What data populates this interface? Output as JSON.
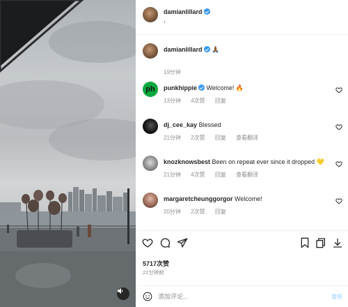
{
  "post": {
    "author": "damianlillard",
    "verified": true,
    "header_subtitle": ".",
    "caption": {
      "username": "damianlillard",
      "text": "🙏🏾",
      "time": "19分钟"
    }
  },
  "comments": [
    {
      "username": "punkhippie",
      "verified": true,
      "text": "Welcome! 🔥",
      "time": "13分钟",
      "likes": "4次赞",
      "reply": "回复",
      "translate": "",
      "avatar_text": "ph"
    },
    {
      "username": "dj_cee_kay",
      "verified": false,
      "text": "Blessed",
      "time": "21分钟",
      "likes": "2次赞",
      "reply": "回复",
      "translate": "查看翻译",
      "avatar_text": ""
    },
    {
      "username": "knozknowsbest",
      "verified": false,
      "text": "Been on repeat ever since it dropped 💛",
      "time": "21分钟",
      "likes": "4次赞",
      "reply": "回复",
      "translate": "查看翻译",
      "avatar_text": ""
    },
    {
      "username": "margaretcheunggorgor",
      "verified": false,
      "text": "Welcome!",
      "time": "20分钟",
      "likes": "2次赞",
      "reply": "回复",
      "translate": "",
      "avatar_text": ""
    }
  ],
  "stats": {
    "likes": "5717次赞",
    "posted": "22分钟前"
  },
  "composer": {
    "placeholder": "添加评论...",
    "post_label": "发布"
  },
  "icons": {
    "like": "heart-icon",
    "comment": "comment-icon",
    "share": "send-icon",
    "save": "bookmark-icon",
    "collection": "collection-icon",
    "download": "download-icon",
    "mute": "speaker-icon",
    "emoji": "emoji-icon"
  },
  "colors": {
    "verified": "#3897f0",
    "muted_text": "#8e8e8e",
    "post_disabled": "#b3dbff"
  }
}
